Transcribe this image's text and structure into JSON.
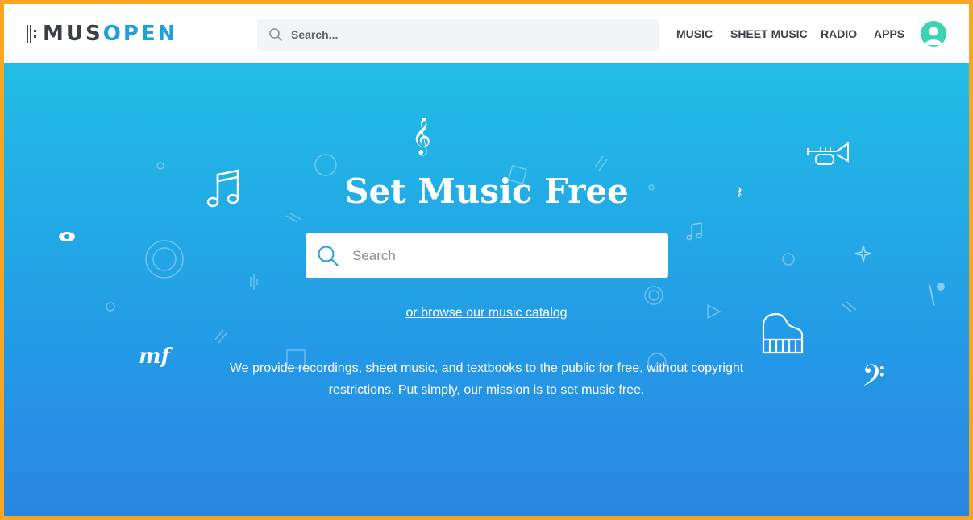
{
  "brand": {
    "logo_left": "MUS",
    "logo_right": "OPEN"
  },
  "header": {
    "search_placeholder": "Search...",
    "nav": [
      {
        "label": "MUSIC"
      },
      {
        "label": "SHEET MUSIC"
      },
      {
        "label": "RADIO"
      },
      {
        "label": "APPS"
      }
    ]
  },
  "hero": {
    "title": "Set Music Free",
    "search_placeholder": "Search",
    "browse_link": "or browse our music catalog",
    "mission_text": "We provide recordings, sheet music, and textbooks to the public for free, without copyright restrictions. Put simply, our mission is to set music free.",
    "decor_text": {
      "dynamic_marking": "mf"
    }
  },
  "colors": {
    "frame_border": "#f5a623",
    "brand_dark": "#3b3f46",
    "brand_blue": "#1fa0d8",
    "hero_top": "#22bde6",
    "hero_bottom": "#2b85e3",
    "avatar": "#3dd2b4"
  },
  "icons": [
    "search-icon",
    "user-avatar-icon",
    "treble-clef-icon",
    "music-note-icon",
    "trumpet-icon",
    "piano-icon",
    "bass-clef-icon",
    "eye-icon",
    "sparkle-icon",
    "play-icon"
  ]
}
